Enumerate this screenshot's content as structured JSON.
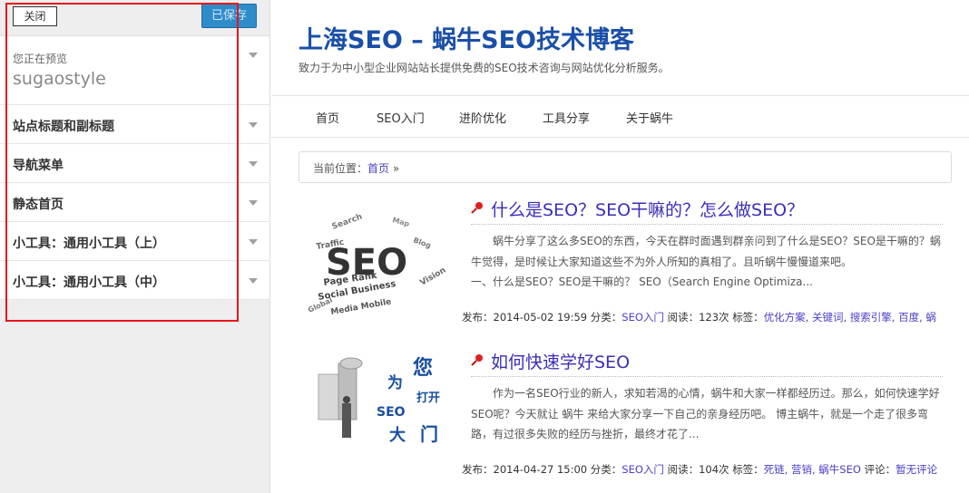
{
  "sidebar": {
    "close_label": "关闭",
    "saved_label": "已保存",
    "preview_label": "您正在预览",
    "theme_name": "sugaostyle",
    "sections": [
      {
        "label": "站点标题和副标题"
      },
      {
        "label": "导航菜单"
      },
      {
        "label": "静态首页"
      },
      {
        "label": "小工具：通用小工具（上）"
      },
      {
        "label": "小工具：通用小工具（中）"
      }
    ]
  },
  "site": {
    "title": "上海SEO – 蜗牛SEO技术博客",
    "description": "致力于为中小型企业网站站长提供免费的SEO技术咨询与网站优化分析服务。"
  },
  "nav": [
    "首页",
    "SEO入门",
    "进阶优化",
    "工具分享",
    "关于蜗牛"
  ],
  "breadcrumb": {
    "prefix": "当前位置：",
    "home": "首页",
    "suffix": " »"
  },
  "posts": [
    {
      "title": "什么是SEO？SEO干嘛的？怎么做SEO？",
      "excerpt": "蜗牛分享了这么多SEO的东西，今天在群时面遇到群亲问到了什么是SEO？SEO是干嘛的？蜗牛觉得，是时候让大家知道这些不为外人所知的真相了。且听蜗牛慢慢道来吧。",
      "excerpt2": "一、什么是SEO？SEO是干嘛的？ SEO（Search Engine Optimiza...",
      "meta_published": "发布：2014-05-02 19:59",
      "meta_category_label": "分类：",
      "meta_category": "SEO入门",
      "meta_views": "阅读：123次",
      "meta_tags_label": "标签：",
      "meta_tags": "优化方案, 关键词, 搜索引擎, 百度, 蜗",
      "meta_comments_label": "",
      "meta_comments": ""
    },
    {
      "title": "如何快速学好SEO",
      "excerpt": "作为一名SEO行业的新人，求知若渴的心情，蜗牛和大家一样都经历过。那么，如何快速学好SEO呢？今天就让 蜗牛 来给大家分享一下自己的亲身经历吧。 博主蜗牛，就是一个走了很多弯路，有过很多失败的经历与挫折，最终才花了...",
      "excerpt2": "",
      "meta_published": "发布：2014-04-27 15:00",
      "meta_category_label": "分类：",
      "meta_category": "SEO入门",
      "meta_views": "阅读：104次",
      "meta_tags_label": "标签：",
      "meta_tags": "死链, 营销, 蜗牛SEO",
      "meta_comments_label": "评论：",
      "meta_comments": "暂无评论"
    }
  ],
  "thumb1": {
    "big_text": "SEO",
    "words": [
      "Page Rank",
      "Social Business",
      "Media Mobile",
      "Search",
      "Global",
      "Vision",
      "Map",
      "Traffic",
      "Blog"
    ]
  },
  "thumb2": {
    "chars": [
      "为",
      "您",
      "打开",
      "SEO",
      "大",
      "门"
    ]
  },
  "colors": {
    "accent_blue": "#2e8ccb",
    "highlight_red": "#e8141b",
    "link_purple": "#4a41c6",
    "title_blue": "#1a4fa8"
  }
}
